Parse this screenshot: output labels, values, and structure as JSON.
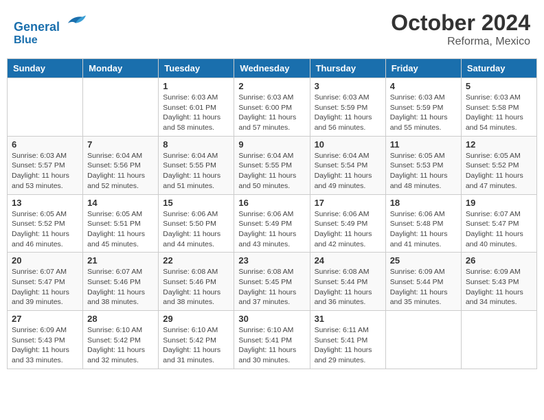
{
  "header": {
    "logo_line1": "General",
    "logo_line2": "Blue",
    "month": "October 2024",
    "location": "Reforma, Mexico"
  },
  "weekdays": [
    "Sunday",
    "Monday",
    "Tuesday",
    "Wednesday",
    "Thursday",
    "Friday",
    "Saturday"
  ],
  "weeks": [
    [
      {
        "day": "",
        "info": ""
      },
      {
        "day": "",
        "info": ""
      },
      {
        "day": "1",
        "info": "Sunrise: 6:03 AM\nSunset: 6:01 PM\nDaylight: 11 hours and 58 minutes."
      },
      {
        "day": "2",
        "info": "Sunrise: 6:03 AM\nSunset: 6:00 PM\nDaylight: 11 hours and 57 minutes."
      },
      {
        "day": "3",
        "info": "Sunrise: 6:03 AM\nSunset: 5:59 PM\nDaylight: 11 hours and 56 minutes."
      },
      {
        "day": "4",
        "info": "Sunrise: 6:03 AM\nSunset: 5:59 PM\nDaylight: 11 hours and 55 minutes."
      },
      {
        "day": "5",
        "info": "Sunrise: 6:03 AM\nSunset: 5:58 PM\nDaylight: 11 hours and 54 minutes."
      }
    ],
    [
      {
        "day": "6",
        "info": "Sunrise: 6:03 AM\nSunset: 5:57 PM\nDaylight: 11 hours and 53 minutes."
      },
      {
        "day": "7",
        "info": "Sunrise: 6:04 AM\nSunset: 5:56 PM\nDaylight: 11 hours and 52 minutes."
      },
      {
        "day": "8",
        "info": "Sunrise: 6:04 AM\nSunset: 5:55 PM\nDaylight: 11 hours and 51 minutes."
      },
      {
        "day": "9",
        "info": "Sunrise: 6:04 AM\nSunset: 5:55 PM\nDaylight: 11 hours and 50 minutes."
      },
      {
        "day": "10",
        "info": "Sunrise: 6:04 AM\nSunset: 5:54 PM\nDaylight: 11 hours and 49 minutes."
      },
      {
        "day": "11",
        "info": "Sunrise: 6:05 AM\nSunset: 5:53 PM\nDaylight: 11 hours and 48 minutes."
      },
      {
        "day": "12",
        "info": "Sunrise: 6:05 AM\nSunset: 5:52 PM\nDaylight: 11 hours and 47 minutes."
      }
    ],
    [
      {
        "day": "13",
        "info": "Sunrise: 6:05 AM\nSunset: 5:52 PM\nDaylight: 11 hours and 46 minutes."
      },
      {
        "day": "14",
        "info": "Sunrise: 6:05 AM\nSunset: 5:51 PM\nDaylight: 11 hours and 45 minutes."
      },
      {
        "day": "15",
        "info": "Sunrise: 6:06 AM\nSunset: 5:50 PM\nDaylight: 11 hours and 44 minutes."
      },
      {
        "day": "16",
        "info": "Sunrise: 6:06 AM\nSunset: 5:49 PM\nDaylight: 11 hours and 43 minutes."
      },
      {
        "day": "17",
        "info": "Sunrise: 6:06 AM\nSunset: 5:49 PM\nDaylight: 11 hours and 42 minutes."
      },
      {
        "day": "18",
        "info": "Sunrise: 6:06 AM\nSunset: 5:48 PM\nDaylight: 11 hours and 41 minutes."
      },
      {
        "day": "19",
        "info": "Sunrise: 6:07 AM\nSunset: 5:47 PM\nDaylight: 11 hours and 40 minutes."
      }
    ],
    [
      {
        "day": "20",
        "info": "Sunrise: 6:07 AM\nSunset: 5:47 PM\nDaylight: 11 hours and 39 minutes."
      },
      {
        "day": "21",
        "info": "Sunrise: 6:07 AM\nSunset: 5:46 PM\nDaylight: 11 hours and 38 minutes."
      },
      {
        "day": "22",
        "info": "Sunrise: 6:08 AM\nSunset: 5:46 PM\nDaylight: 11 hours and 38 minutes."
      },
      {
        "day": "23",
        "info": "Sunrise: 6:08 AM\nSunset: 5:45 PM\nDaylight: 11 hours and 37 minutes."
      },
      {
        "day": "24",
        "info": "Sunrise: 6:08 AM\nSunset: 5:44 PM\nDaylight: 11 hours and 36 minutes."
      },
      {
        "day": "25",
        "info": "Sunrise: 6:09 AM\nSunset: 5:44 PM\nDaylight: 11 hours and 35 minutes."
      },
      {
        "day": "26",
        "info": "Sunrise: 6:09 AM\nSunset: 5:43 PM\nDaylight: 11 hours and 34 minutes."
      }
    ],
    [
      {
        "day": "27",
        "info": "Sunrise: 6:09 AM\nSunset: 5:43 PM\nDaylight: 11 hours and 33 minutes."
      },
      {
        "day": "28",
        "info": "Sunrise: 6:10 AM\nSunset: 5:42 PM\nDaylight: 11 hours and 32 minutes."
      },
      {
        "day": "29",
        "info": "Sunrise: 6:10 AM\nSunset: 5:42 PM\nDaylight: 11 hours and 31 minutes."
      },
      {
        "day": "30",
        "info": "Sunrise: 6:10 AM\nSunset: 5:41 PM\nDaylight: 11 hours and 30 minutes."
      },
      {
        "day": "31",
        "info": "Sunrise: 6:11 AM\nSunset: 5:41 PM\nDaylight: 11 hours and 29 minutes."
      },
      {
        "day": "",
        "info": ""
      },
      {
        "day": "",
        "info": ""
      }
    ]
  ]
}
